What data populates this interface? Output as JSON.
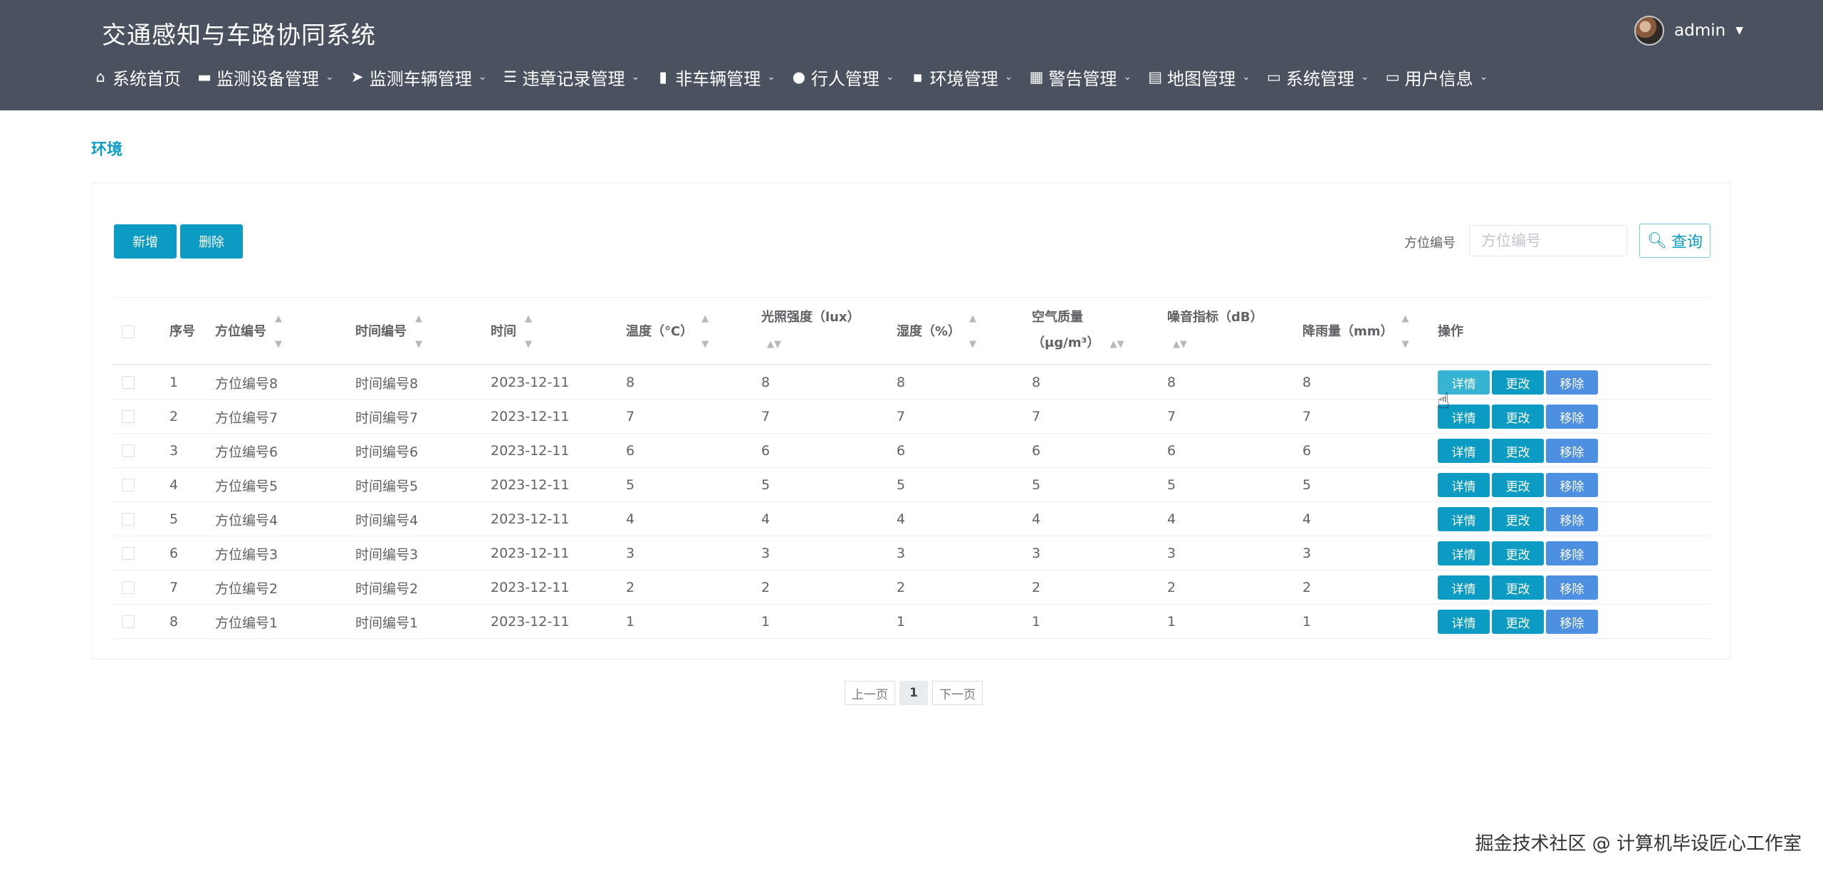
{
  "header": {
    "title": "交通感知与车路协同系统",
    "user": "admin"
  },
  "nav": [
    {
      "label": "系统首页",
      "icon": "home-icon",
      "glyph": "⌂",
      "has_menu": false
    },
    {
      "label": "监测设备管理",
      "icon": "briefcase-icon",
      "glyph": "▬",
      "has_menu": true
    },
    {
      "label": "监测车辆管理",
      "icon": "send-icon",
      "glyph": "➤",
      "has_menu": true
    },
    {
      "label": "违章记录管理",
      "icon": "sliders-icon",
      "glyph": "☰",
      "has_menu": true
    },
    {
      "label": "非车辆管理",
      "icon": "book-icon",
      "glyph": "▮",
      "has_menu": true
    },
    {
      "label": "行人管理",
      "icon": "user-icon",
      "glyph": "●",
      "has_menu": true
    },
    {
      "label": "环境管理",
      "icon": "comment-icon",
      "glyph": "▪",
      "has_menu": true
    },
    {
      "label": "警告管理",
      "icon": "grid-icon",
      "glyph": "▦",
      "has_menu": true
    },
    {
      "label": "地图管理",
      "icon": "clipboard-icon",
      "glyph": "▤",
      "has_menu": true
    },
    {
      "label": "系统管理",
      "icon": "desktop-icon",
      "glyph": "▭",
      "has_menu": true
    },
    {
      "label": "用户信息",
      "icon": "id-card-icon",
      "glyph": "▭",
      "has_menu": true
    }
  ],
  "breadcrumb": "环境",
  "toolbar": {
    "add_label": "新增",
    "delete_label": "删除",
    "search_label": "方位编号",
    "search_placeholder": "方位编号",
    "search_value": "",
    "query_label": "查询"
  },
  "table": {
    "columns": [
      "序号",
      "方位编号",
      "时间编号",
      "时间",
      "温度（°C）",
      "光照强度（lux）",
      "湿度（%）",
      "空气质量（μg/m³）",
      "噪音指标（dB）",
      "降雨量（mm）",
      "操作"
    ],
    "rows": [
      {
        "idx": "1",
        "position": "方位编号8",
        "time_no": "时间编号8",
        "time": "2023-12-11",
        "temp": "8",
        "light": "8",
        "humidity": "8",
        "air": "8",
        "noise": "8",
        "rain": "8"
      },
      {
        "idx": "2",
        "position": "方位编号7",
        "time_no": "时间编号7",
        "time": "2023-12-11",
        "temp": "7",
        "light": "7",
        "humidity": "7",
        "air": "7",
        "noise": "7",
        "rain": "7"
      },
      {
        "idx": "3",
        "position": "方位编号6",
        "time_no": "时间编号6",
        "time": "2023-12-11",
        "temp": "6",
        "light": "6",
        "humidity": "6",
        "air": "6",
        "noise": "6",
        "rain": "6"
      },
      {
        "idx": "4",
        "position": "方位编号5",
        "time_no": "时间编号5",
        "time": "2023-12-11",
        "temp": "5",
        "light": "5",
        "humidity": "5",
        "air": "5",
        "noise": "5",
        "rain": "5"
      },
      {
        "idx": "5",
        "position": "方位编号4",
        "time_no": "时间编号4",
        "time": "2023-12-11",
        "temp": "4",
        "light": "4",
        "humidity": "4",
        "air": "4",
        "noise": "4",
        "rain": "4"
      },
      {
        "idx": "6",
        "position": "方位编号3",
        "time_no": "时间编号3",
        "time": "2023-12-11",
        "temp": "3",
        "light": "3",
        "humidity": "3",
        "air": "3",
        "noise": "3",
        "rain": "3"
      },
      {
        "idx": "7",
        "position": "方位编号2",
        "time_no": "时间编号2",
        "time": "2023-12-11",
        "temp": "2",
        "light": "2",
        "humidity": "2",
        "air": "2",
        "noise": "2",
        "rain": "2"
      },
      {
        "idx": "8",
        "position": "方位编号1",
        "time_no": "时间编号1",
        "time": "2023-12-11",
        "temp": "1",
        "light": "1",
        "humidity": "1",
        "air": "1",
        "noise": "1",
        "rain": "1"
      }
    ],
    "row_actions": {
      "detail": "详情",
      "edit": "更改",
      "remove": "移除"
    }
  },
  "pagination": {
    "prev": "上一页",
    "current": "1",
    "next": "下一页"
  },
  "watermark": "掘金技术社区 @ 计算机毕设匠心工作室",
  "colors": {
    "header_bg": "#4b525f",
    "primary": "#0b9bc3",
    "remove": "#4d8fe0",
    "breadcrumb": "#0f9ec4"
  }
}
